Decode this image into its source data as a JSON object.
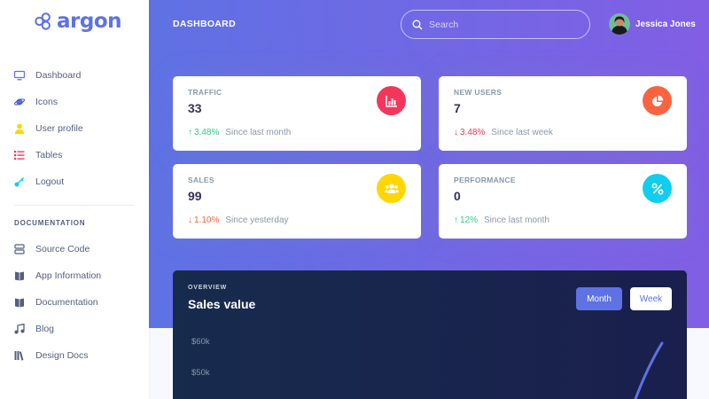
{
  "brand": {
    "name": "argon",
    "color": "#5e72e4"
  },
  "sidebar": {
    "items": [
      {
        "label": "Dashboard",
        "icon": "tv-icon",
        "color": "#5e72e4"
      },
      {
        "label": "Icons",
        "icon": "planet-icon",
        "color": "#5e72e4"
      },
      {
        "label": "User profile",
        "icon": "user-icon",
        "color": "#ffd600"
      },
      {
        "label": "Tables",
        "icon": "bullet-list-icon",
        "color": "#f5365c"
      },
      {
        "label": "Logout",
        "icon": "key-icon",
        "color": "#11cdef"
      }
    ],
    "doc_heading": "DOCUMENTATION",
    "doc_items": [
      {
        "label": "Source Code",
        "icon": "code-icon"
      },
      {
        "label": "App Information",
        "icon": "book-icon"
      },
      {
        "label": "Documentation",
        "icon": "book-icon"
      },
      {
        "label": "Blog",
        "icon": "music-icon"
      },
      {
        "label": "Design Docs",
        "icon": "library-icon"
      }
    ]
  },
  "header": {
    "title": "DASHBOARD",
    "search_placeholder": "Search",
    "user_name": "Jessica Jones"
  },
  "stats": [
    {
      "title": "TRAFFIC",
      "value": "33",
      "trend": "up",
      "pct": "3.48%",
      "since": "Since last month",
      "icon": "chart-bar-icon",
      "color": "#f5365c"
    },
    {
      "title": "NEW USERS",
      "value": "7",
      "trend": "down",
      "pct": "3.48%",
      "since": "Since last week",
      "icon": "chart-pie-icon",
      "color": "#fb6340"
    },
    {
      "title": "SALES",
      "value": "99",
      "trend": "down",
      "pct": "1.10%",
      "since": "Since yesterday",
      "icon": "users-icon",
      "color": "#ffd600"
    },
    {
      "title": "PERFORMANCE",
      "value": "0",
      "trend": "up",
      "pct": "12%",
      "since": "Since last month",
      "icon": "percent-icon",
      "color": "#11cdef"
    }
  ],
  "overview": {
    "subtitle": "OVERVIEW",
    "title": "Sales value",
    "buttons": {
      "month": "Month",
      "week": "Week"
    },
    "active": "Month"
  },
  "chart_data": {
    "type": "line",
    "title": "Sales value",
    "y_ticks": [
      "$60k",
      "$50k"
    ],
    "series_color": "#5e72e4"
  }
}
